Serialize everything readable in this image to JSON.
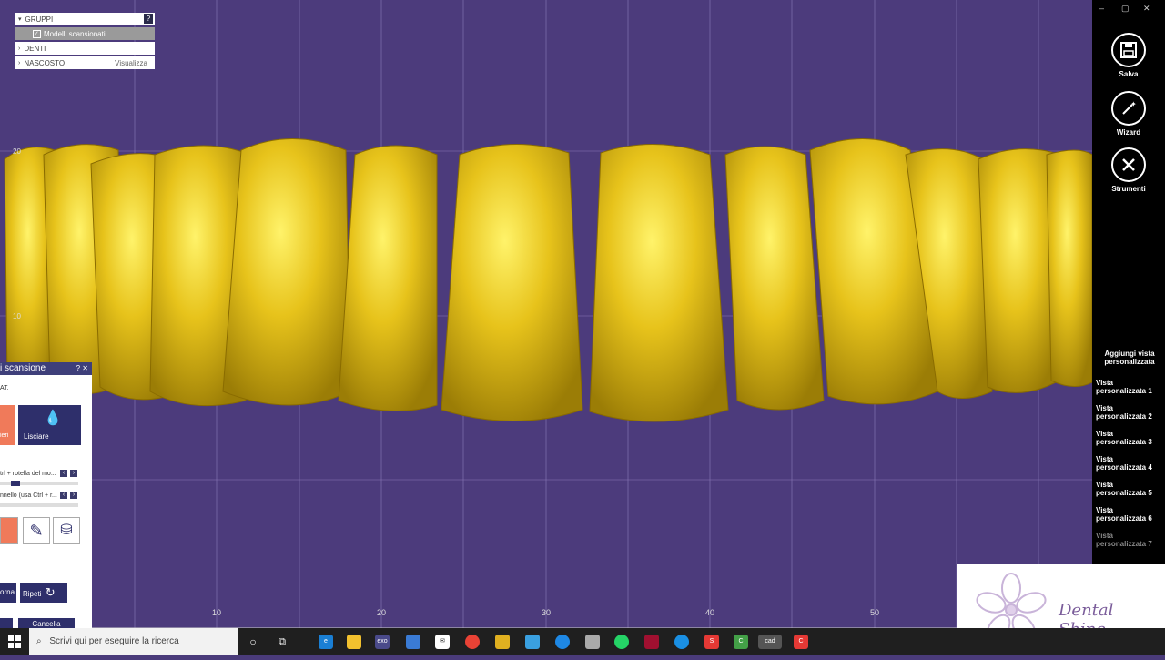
{
  "tree": {
    "groups_label": "GRUPPI",
    "help_label": "?",
    "scanned_models_label": "Modelli scansionati",
    "teeth_label": "DENTI",
    "hidden_label": "NASCOSTO",
    "show_label": "Visualizza"
  },
  "axis": {
    "y_labels": [
      "20",
      "10"
    ],
    "x_labels": [
      "10",
      "20",
      "30",
      "40",
      "50"
    ]
  },
  "scan_panel": {
    "title": "i scansione",
    "header_buttons": "? ✕",
    "subtitle": "AT.",
    "tool_partial_label": "ieri",
    "smooth_label": "Lisciare",
    "hint1": "trl + rotella del mo...",
    "hint2": "nnello (usa Ctrl + r...",
    "back_label": "orna",
    "redo_label": "Ripeti",
    "cancel_label": "Cancella"
  },
  "sidebar": {
    "window_controls": [
      "–",
      "▢",
      "✕"
    ],
    "save_label": "Salva",
    "wizard_label": "Wizard",
    "tools_label": "Strumenti",
    "add_view_label": "Aggiungi vista personalizzata",
    "views": [
      "Vista personalizzata 1",
      "Vista personalizzata 2",
      "Vista personalizzata 3",
      "Vista personalizzata 4",
      "Vista personalizzata 5",
      "Vista personalizzata 6",
      "Vista personalizzata 7"
    ]
  },
  "logo": {
    "text": "Dental Shine"
  },
  "taskbar": {
    "search_placeholder": "Scrivi qui per eseguire la ricerca",
    "apps": [
      "exo",
      "cad"
    ]
  },
  "colors": {
    "background": "#4c3b7c",
    "tooth": "#e6c21a",
    "panel_dark": "#2e2f6b",
    "accent_orange": "#f07a5a"
  }
}
